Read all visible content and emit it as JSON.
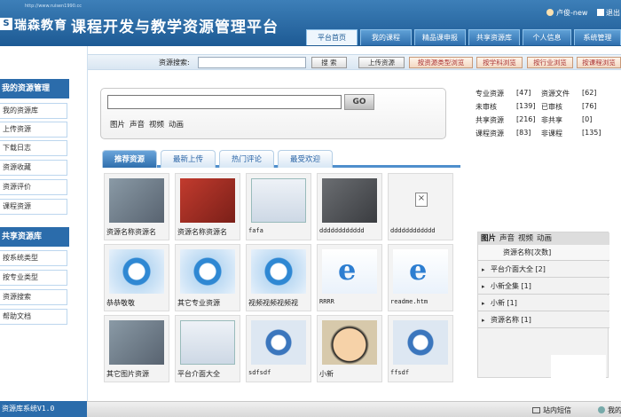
{
  "header": {
    "logo_url": "http://www.ruisen1990.cc",
    "logo_mark": "S",
    "logo_name": "瑞森教育",
    "title": "课程开发与教学资源管理平台",
    "user": "卢俊-new",
    "logout": "退出",
    "nav_tabs": [
      "平台首页",
      "我的课程",
      "精品课申报",
      "共享资源库",
      "个人信息",
      "系统管理"
    ]
  },
  "sidebar": {
    "my_section": "我的资源管理",
    "my_items": [
      "我的资源库",
      "上传资源",
      "下载日志",
      "资源收藏",
      "资源评价",
      "课程资源"
    ],
    "shared_section": "共享资源库",
    "shared_items": [
      "按系统类型",
      "按专业类型",
      "资源搜索",
      "帮助文档"
    ],
    "version": "资源库系统V1.0"
  },
  "toolbar": {
    "search_label": "资源搜索:",
    "search_button": "搜 索",
    "upload_button": "上传资源",
    "browse_type": "按资源类型浏览",
    "browse_subject": "按学科浏览",
    "browse_industry": "按行业浏览",
    "browse_course": "按课程浏览"
  },
  "search_box": {
    "go_label": "GO",
    "filters": [
      "图片",
      "声音",
      "视频",
      "动画"
    ]
  },
  "stats": [
    {
      "label": "专业资源",
      "value": "[47]",
      "label2": "资源文件",
      "value2": "[62]"
    },
    {
      "label": "未审核",
      "value": "[139]",
      "label2": "已审核",
      "value2": "[76]"
    },
    {
      "label": "共享资源",
      "value": "[216]",
      "label2": "非共享",
      "value2": "[0]"
    },
    {
      "label": "课程资源",
      "value": "[83]",
      "label2": "非课程",
      "value2": "[135]"
    }
  ],
  "resource_tabs": [
    "推荐资源",
    "最新上传",
    "热门评论",
    "最受欢迎"
  ],
  "resources": [
    {
      "caption": "资源名称资源名",
      "icon": "photo-icon"
    },
    {
      "caption": "资源名称资源名",
      "icon": "photo-icon"
    },
    {
      "caption": "fafa",
      "icon": "screenshot-icon"
    },
    {
      "caption": "dddddddddddd",
      "icon": "photo-icon"
    },
    {
      "caption": "dddddddddddd",
      "icon": "broken-image-icon"
    },
    {
      "caption": "恭恭敬敬",
      "icon": "media-player-icon"
    },
    {
      "caption": "其它专业资源",
      "icon": "media-player-icon"
    },
    {
      "caption": "视频视频视频视",
      "icon": "media-player-icon"
    },
    {
      "caption": "RRRR",
      "icon": "ie-icon"
    },
    {
      "caption": "readme.htm",
      "icon": "ie-icon"
    },
    {
      "caption": "其它图片资源",
      "icon": "photo-icon"
    },
    {
      "caption": "平台介面大全",
      "icon": "screenshot-icon"
    },
    {
      "caption": "sdfsdf",
      "icon": "quicktime-icon"
    },
    {
      "caption": "小新",
      "icon": "cartoon-face-icon"
    },
    {
      "caption": "ffsdf",
      "icon": "quicktime-icon"
    }
  ],
  "panel": {
    "tabs": [
      "图片",
      "声音",
      "视频",
      "动画"
    ],
    "header": "资源名称[次数]",
    "rows": [
      "平台介面大全 [2]",
      "小新全集 [1]",
      "小新 [1]",
      "资源名称 [1]"
    ]
  },
  "footer": {
    "messages": "站内短信",
    "mine": "我的"
  }
}
